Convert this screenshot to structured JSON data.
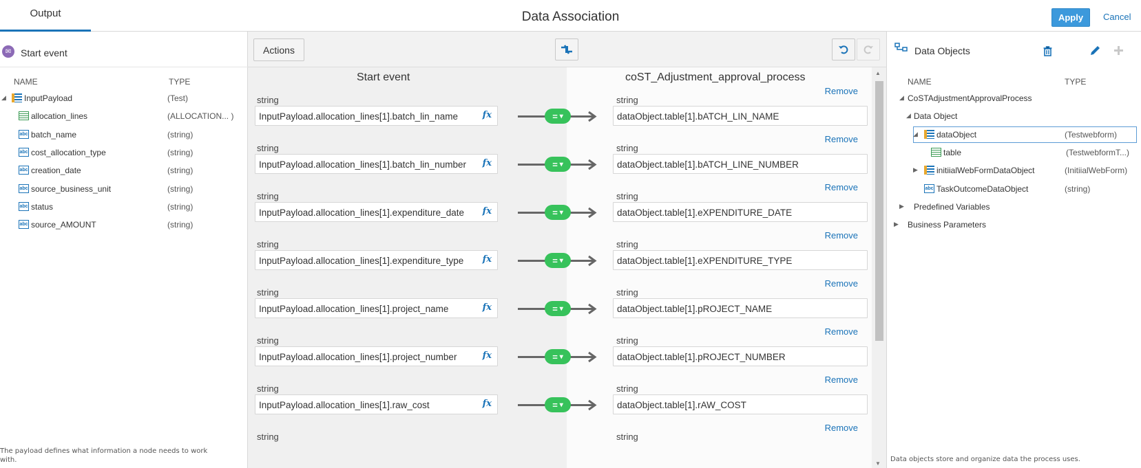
{
  "header": {
    "tab_output": "Output",
    "title": "Data Association",
    "apply_label": "Apply",
    "cancel_label": "Cancel"
  },
  "left_panel": {
    "title": "Start event",
    "col_name": "NAME",
    "col_type": "TYPE",
    "items": [
      {
        "name": "InputPayload",
        "type": "(Test)",
        "icon": "payload-icon",
        "level": 0,
        "expanded": true
      },
      {
        "name": "allocation_lines",
        "type": "(ALLOCATION... )",
        "icon": "table-icon",
        "level": 1
      },
      {
        "name": "batch_name",
        "type": "(string)",
        "icon": "string-icon",
        "level": 1
      },
      {
        "name": "cost_allocation_type",
        "type": "(string)",
        "icon": "string-icon",
        "level": 1
      },
      {
        "name": "creation_date",
        "type": "(string)",
        "icon": "string-icon",
        "level": 1
      },
      {
        "name": "source_business_unit",
        "type": "(string)",
        "icon": "string-icon",
        "level": 1
      },
      {
        "name": "status",
        "type": "(string)",
        "icon": "string-icon",
        "level": 1
      },
      {
        "name": "source_AMOUNT",
        "type": "(string)",
        "icon": "string-icon",
        "level": 1
      }
    ],
    "footnote_line1": "The payload defines what information a node needs to work",
    "footnote_line2": "with."
  },
  "center": {
    "actions_label": "Actions",
    "left_col_title": "Start event",
    "right_col_title": "coST_Adjustment_approval_process",
    "fx_label": "fx",
    "eq_label": "=",
    "remove_label": "Remove",
    "mappings": [
      {
        "src_type": "string",
        "src": "InputPayload.allocation_lines[1].batch_lin_name",
        "dst_type": "string",
        "dst": "dataObject.table[1].bATCH_LIN_NAME"
      },
      {
        "src_type": "string",
        "src": "InputPayload.allocation_lines[1].batch_lin_number",
        "dst_type": "string",
        "dst": "dataObject.table[1].bATCH_LINE_NUMBER"
      },
      {
        "src_type": "string",
        "src": "InputPayload.allocation_lines[1].expenditure_date",
        "dst_type": "string",
        "dst": "dataObject.table[1].eXPENDITURE_DATE"
      },
      {
        "src_type": "string",
        "src": "InputPayload.allocation_lines[1].expenditure_type",
        "dst_type": "string",
        "dst": "dataObject.table[1].eXPENDITURE_TYPE"
      },
      {
        "src_type": "string",
        "src": "InputPayload.allocation_lines[1].project_name",
        "dst_type": "string",
        "dst": "dataObject.table[1].pROJECT_NAME"
      },
      {
        "src_type": "string",
        "src": "InputPayload.allocation_lines[1].project_number",
        "dst_type": "string",
        "dst": "dataObject.table[1].pROJECT_NUMBER"
      },
      {
        "src_type": "string",
        "src": "InputPayload.allocation_lines[1].raw_cost",
        "dst_type": "string",
        "dst": "dataObject.table[1].rAW_COST"
      },
      {
        "src_type": "string",
        "src": "",
        "dst_type": "string",
        "dst": ""
      }
    ]
  },
  "right_panel": {
    "title": "Data Objects",
    "col_name": "NAME",
    "col_type": "TYPE",
    "items": [
      {
        "name": "CoSTAdjustmentApprovalProcess",
        "type": "",
        "icon": "",
        "tri": "expanded"
      },
      {
        "name": "Data Object",
        "type": "",
        "icon": "",
        "tri": "expanded"
      },
      {
        "name": "dataObject",
        "type": "(Testwebform)",
        "icon": "payload-icon",
        "tri": "expanded",
        "selected": true
      },
      {
        "name": "table",
        "type": "(TestwebformT...)",
        "icon": "table-icon",
        "tri": ""
      },
      {
        "name": "initiialWebFormDataObject",
        "type": "(InitiialWebForm)",
        "icon": "payload-icon",
        "tri": "collapsed"
      },
      {
        "name": "TaskOutcomeDataObject",
        "type": "(string)",
        "icon": "string-icon",
        "tri": ""
      },
      {
        "name": "Predefined Variables",
        "type": "",
        "icon": "",
        "tri": "collapsed"
      },
      {
        "name": "Business Parameters",
        "type": "",
        "icon": "",
        "tri": "collapsed"
      }
    ],
    "footnote": "Data objects store and organize data the process uses."
  },
  "colors": {
    "accent": "#1a73b8",
    "apply_bg": "#3c99dc",
    "connector_green": "#37c25b",
    "start_event_purple": "#8c6ab6"
  }
}
